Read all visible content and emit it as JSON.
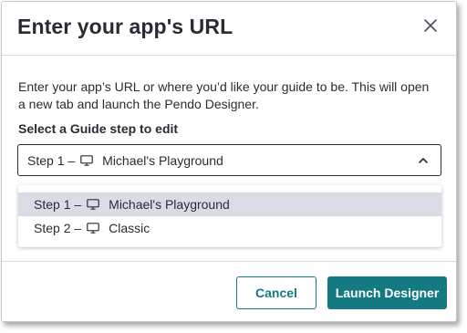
{
  "modal": {
    "title": "Enter your app's URL",
    "description": "Enter your app’s URL or where you’d like your guide to be. This will open a new tab and launch the Pendo Designer.",
    "select_label": "Select a Guide step to edit",
    "select": {
      "value_prefix": "Step 1 –",
      "value_icon": "desktop-monitor-icon",
      "value_name": "Michael's Playground"
    },
    "options": [
      {
        "prefix": "Step 1 –",
        "icon": "desktop-monitor-icon",
        "name": "Michael's Playground",
        "selected": true
      },
      {
        "prefix": "Step 2 –",
        "icon": "desktop-monitor-icon",
        "name": "Classic",
        "selected": false
      }
    ],
    "buttons": {
      "cancel_label": "Cancel",
      "launch_label": "Launch Designer"
    }
  },
  "colors": {
    "accent": "#127a80",
    "text": "#2a2c35",
    "highlight": "#dadce5",
    "divider": "#dadce0"
  }
}
